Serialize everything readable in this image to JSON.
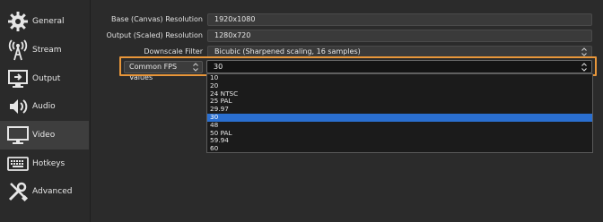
{
  "sidebar": {
    "items": [
      {
        "label": "General",
        "icon": "gear-icon"
      },
      {
        "label": "Stream",
        "icon": "stream-icon"
      },
      {
        "label": "Output",
        "icon": "output-icon"
      },
      {
        "label": "Audio",
        "icon": "speaker-icon"
      },
      {
        "label": "Video",
        "icon": "monitor-icon"
      },
      {
        "label": "Hotkeys",
        "icon": "keyboard-icon"
      },
      {
        "label": "Advanced",
        "icon": "tools-icon"
      }
    ],
    "selected": "Video"
  },
  "video": {
    "base_resolution": {
      "label": "Base (Canvas) Resolution",
      "value": "1920x1080"
    },
    "output_resolution": {
      "label": "Output (Scaled) Resolution",
      "value": "1280x720"
    },
    "downscale_filter": {
      "label": "Downscale Filter",
      "value": "Bicubic (Sharpened scaling, 16 samples)"
    },
    "fps": {
      "type_label": "Common FPS Values",
      "value": "30",
      "options": [
        "10",
        "20",
        "24 NTSC",
        "25 PAL",
        "29.97",
        "30",
        "48",
        "50 PAL",
        "59.94",
        "60"
      ],
      "selected": "30"
    }
  },
  "colors": {
    "accent_highlight": "#e8963a",
    "selection": "#2a6fd0",
    "background": "#2b2b2b"
  }
}
